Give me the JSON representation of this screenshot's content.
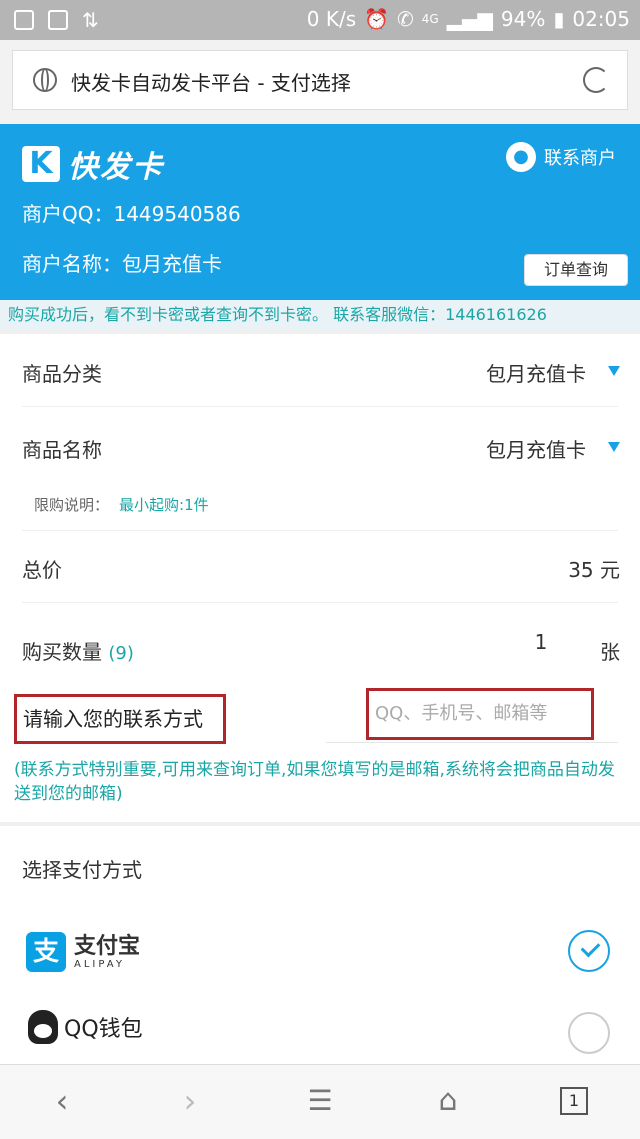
{
  "status": {
    "speed": "0 K/s",
    "network": "4G",
    "battery": "94%",
    "time": "02:05"
  },
  "browser": {
    "page_title": "快发卡自动发卡平台 - 支付选择",
    "tab_count": "1"
  },
  "header": {
    "logo_letter": "K",
    "logo_text": "快发卡",
    "contact_label": "联系商户",
    "merchant_qq": "商户QQ：1449540586",
    "merchant_name": "商户名称：包月充值卡",
    "order_query": "订单查询",
    "brand_color": "#19a1e6"
  },
  "notice": "购买成功后，看不到卡密或者查询不到卡密。 联系客服微信：1446161626",
  "form": {
    "category_label": "商品分类",
    "category_value": "包月充值卡",
    "name_label": "商品名称",
    "name_value": "包月充值卡",
    "limit_label": "限购说明：",
    "limit_value": "最小起购:1件",
    "total_label": "总价",
    "total_value": "35 元",
    "qty_label": "购买数量",
    "qty_count": "(9)",
    "qty_value": "1",
    "qty_unit": "张",
    "contact_label": "请输入您的联系方式",
    "contact_placeholder": "QQ、手机号、邮箱等",
    "help_text": "(联系方式特别重要,可用来查询订单,如果您填写的是邮箱,系统将会把商品自动发送到您的邮箱)"
  },
  "payment": {
    "title": "选择支付方式",
    "alipay_cn": "支付宝",
    "alipay_en": "ALIPAY",
    "qq_wallet": "QQ钱包",
    "selected": "alipay"
  }
}
